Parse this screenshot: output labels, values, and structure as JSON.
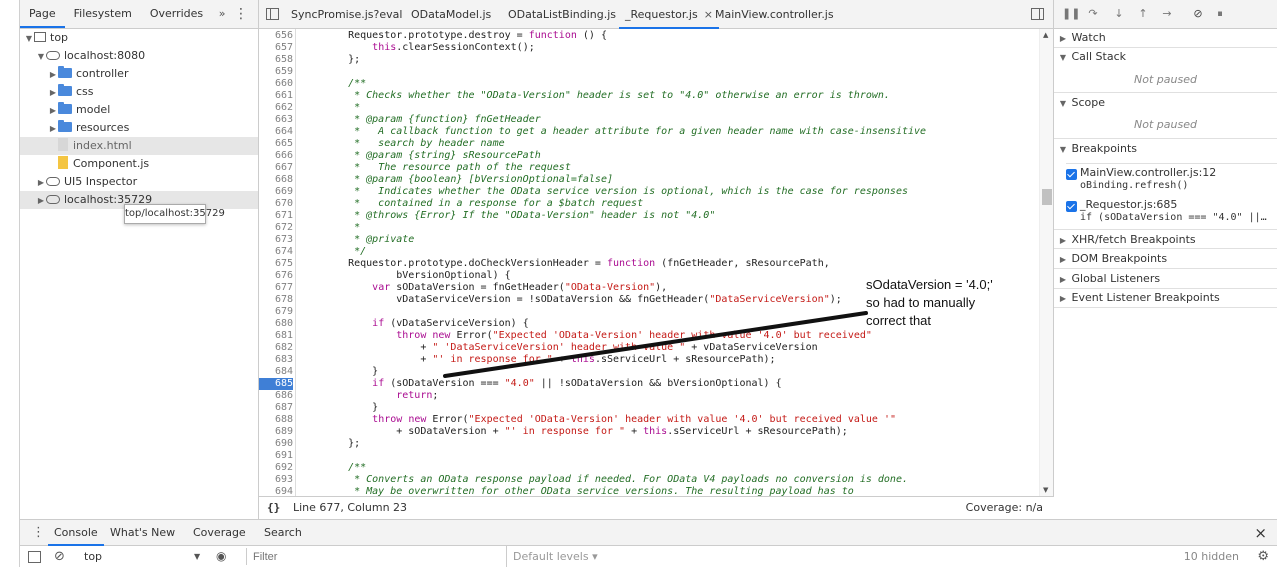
{
  "navigator": {
    "tabs": [
      "Page",
      "Filesystem",
      "Overrides"
    ],
    "more": "»",
    "menu": "⋮",
    "tree": [
      {
        "label": "top",
        "kind": "frame",
        "expanded": true
      },
      {
        "label": "localhost:8080",
        "kind": "cloud",
        "expanded": true
      },
      {
        "label": "controller",
        "kind": "folder"
      },
      {
        "label": "css",
        "kind": "folder"
      },
      {
        "label": "model",
        "kind": "folder"
      },
      {
        "label": "resources",
        "kind": "folder"
      },
      {
        "label": "index.html",
        "kind": "file",
        "selected": true
      },
      {
        "label": "Component.js",
        "kind": "js"
      },
      {
        "label": "UI5 Inspector",
        "kind": "cloud"
      },
      {
        "label": "localhost:35729",
        "kind": "cloud",
        "selected": true
      }
    ],
    "tooltip": "top/localhost:35729"
  },
  "editor": {
    "tabs": [
      {
        "label": "SyncPromise.js?eval"
      },
      {
        "label": "ODataModel.js"
      },
      {
        "label": "ODataListBinding.js"
      },
      {
        "label": "_Requestor.js",
        "active": true,
        "close": "×"
      },
      {
        "label": "MainView.controller.js"
      }
    ],
    "breakpoint_line": "685",
    "lines": [
      {
        "n": "656",
        "t": "    Requestor.prototype.destroy = function () {"
      },
      {
        "n": "657",
        "t": "        this.clearSessionContext();"
      },
      {
        "n": "658",
        "t": "    };"
      },
      {
        "n": "659",
        "t": ""
      },
      {
        "n": "660",
        "t": "    /**"
      },
      {
        "n": "661",
        "t": "     * Checks whether the \"OData-Version\" header is set to \"4.0\" otherwise an error is thrown."
      },
      {
        "n": "662",
        "t": "     *"
      },
      {
        "n": "663",
        "t": "     * @param {function} fnGetHeader"
      },
      {
        "n": "664",
        "t": "     *   A callback function to get a header attribute for a given header name with case-insensitive"
      },
      {
        "n": "665",
        "t": "     *   search by header name"
      },
      {
        "n": "666",
        "t": "     * @param {string} sResourcePath"
      },
      {
        "n": "667",
        "t": "     *   The resource path of the request"
      },
      {
        "n": "668",
        "t": "     * @param {boolean} [bVersionOptional=false]"
      },
      {
        "n": "669",
        "t": "     *   Indicates whether the OData service version is optional, which is the case for responses"
      },
      {
        "n": "670",
        "t": "     *   contained in a response for a $batch request"
      },
      {
        "n": "671",
        "t": "     * @throws {Error} If the \"OData-Version\" header is not \"4.0\""
      },
      {
        "n": "672",
        "t": "     *"
      },
      {
        "n": "673",
        "t": "     * @private"
      },
      {
        "n": "674",
        "t": "     */"
      },
      {
        "n": "675",
        "t": "    Requestor.prototype.doCheckVersionHeader = function (fnGetHeader, sResourcePath,"
      },
      {
        "n": "676",
        "t": "            bVersionOptional) {"
      },
      {
        "n": "677",
        "t": "        var sODataVersion = fnGetHeader(\"OData-Version\"),"
      },
      {
        "n": "678",
        "t": "            vDataServiceVersion = !sODataVersion && fnGetHeader(\"DataServiceVersion\");"
      },
      {
        "n": "679",
        "t": ""
      },
      {
        "n": "680",
        "t": "        if (vDataServiceVersion) {"
      },
      {
        "n": "681",
        "t": "            throw new Error(\"Expected 'OData-Version' header with value '4.0' but received\""
      },
      {
        "n": "682",
        "t": "                + \" 'DataServiceVersion' header with value \" + vDataServiceVersion"
      },
      {
        "n": "683",
        "t": "                + \"' in response for \" + this.sServiceUrl + sResourcePath);"
      },
      {
        "n": "684",
        "t": "        }"
      },
      {
        "n": "685",
        "t": "        if (sODataVersion === \"4.0\" || !sODataVersion && bVersionOptional) {"
      },
      {
        "n": "686",
        "t": "            return;"
      },
      {
        "n": "687",
        "t": "        }"
      },
      {
        "n": "688",
        "t": "        throw new Error(\"Expected 'OData-Version' header with value '4.0' but received value '\""
      },
      {
        "n": "689",
        "t": "            + sODataVersion + \"' in response for \" + this.sServiceUrl + sResourcePath);"
      },
      {
        "n": "690",
        "t": "    };"
      },
      {
        "n": "691",
        "t": ""
      },
      {
        "n": "692",
        "t": "    /**"
      },
      {
        "n": "693",
        "t": "     * Converts an OData response payload if needed. For OData V4 payloads no conversion is done."
      },
      {
        "n": "694",
        "t": "     * May be overwritten for other OData service versions. The resulting payload has to"
      }
    ],
    "status": {
      "braces": "{}",
      "position": "Line 677, Column 23",
      "coverage": "Coverage: n/a"
    }
  },
  "annotation": {
    "text": "sOdataVersion = '4.0;'\nso had to manually\ncorrect that"
  },
  "debugger": {
    "toolbar": [
      "pause-icon",
      "step-over-icon",
      "step-into-icon",
      "step-out-icon",
      "step-icon",
      "deactivate-breakpoints-icon",
      "pause-on-exceptions-icon"
    ],
    "sections": {
      "watch": "Watch",
      "callstack": "Call Stack",
      "callstack_status": "Not paused",
      "scope": "Scope",
      "scope_status": "Not paused",
      "breakpoints": "Breakpoints",
      "xhr": "XHR/fetch Breakpoints",
      "dom": "DOM Breakpoints",
      "global": "Global Listeners",
      "event": "Event Listener Breakpoints"
    },
    "breakpoints": [
      {
        "file": "MainView.controller.js:12",
        "code": "oBinding.refresh()"
      },
      {
        "file": "_Requestor.js:685",
        "code": "if (sODataVersion === \"4.0\" ||…"
      }
    ]
  },
  "drawer": {
    "tabs": [
      "Console",
      "What's New",
      "Coverage",
      "Search"
    ],
    "close": "×",
    "context": "top",
    "filter_placeholder": "Filter",
    "levels": "Default levels ▾",
    "hidden": "10 hidden"
  },
  "colors": {
    "accent": "#1a73e8",
    "breakpoint": "#3f7fd6",
    "comment": "#236e25",
    "keyword": "#aa0d91",
    "string": "#c41a16"
  }
}
